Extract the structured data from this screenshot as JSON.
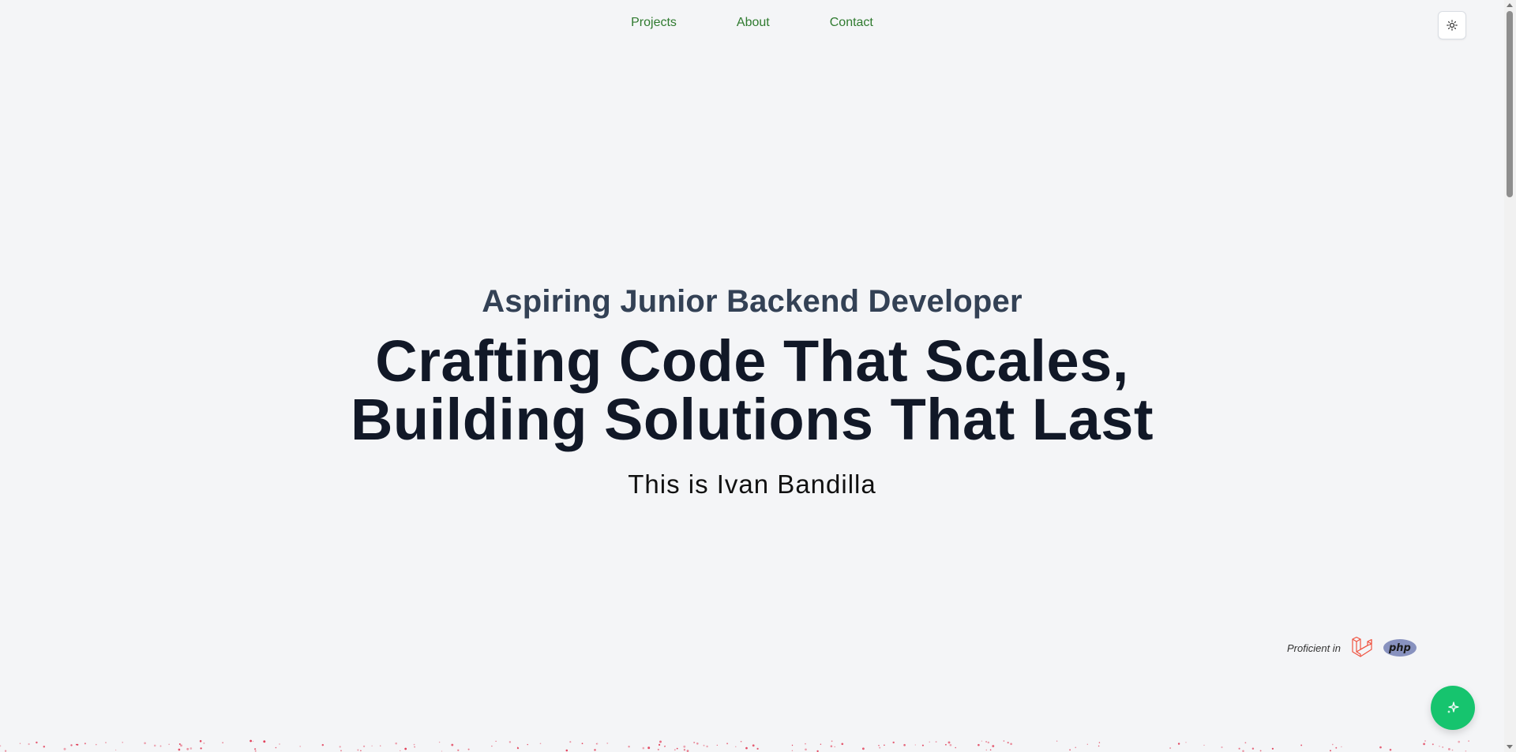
{
  "nav": {
    "items": [
      {
        "label": "Projects"
      },
      {
        "label": "About"
      },
      {
        "label": "Contact"
      }
    ]
  },
  "theme_toggle": {
    "icon": "sun-icon"
  },
  "hero": {
    "subtitle": "Aspiring Junior Backend Developer",
    "headline_line1": "Crafting Code That Scales,",
    "headline_line2": "Building Solutions That Last",
    "intro": "This is Ivan Bandilla"
  },
  "proficient": {
    "label": "Proficient in",
    "php_label": "php",
    "laravel_icon": "laravel-logo-icon"
  },
  "fab": {
    "icon": "sparkle-icon"
  },
  "colors": {
    "background": "#f4f5f7",
    "nav_link": "#2f7a2f",
    "fab": "#16c46e",
    "laravel": "#f05340",
    "php": "#8892bf",
    "particles": "#e0334f"
  }
}
